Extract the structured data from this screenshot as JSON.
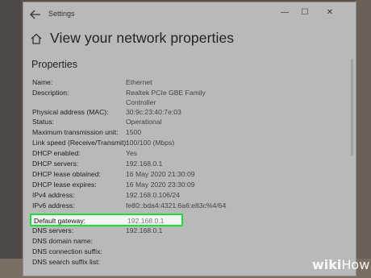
{
  "window": {
    "app_title": "Settings",
    "page_title": "View your network properties",
    "section_title": "Properties",
    "controls": {
      "minimize": "—",
      "maximize": "☐",
      "close": "✕"
    }
  },
  "properties": [
    {
      "label": "Name:",
      "value": "Ethernet"
    },
    {
      "label": "Description:",
      "value": "Realtek PCIe GBE Family"
    },
    {
      "label": "",
      "value": "Controller"
    },
    {
      "label": "Physical address (MAC):",
      "value": "30:9c:23:40:7e:03"
    },
    {
      "label": "Status:",
      "value": "Operational"
    },
    {
      "label": "Maximum transmission unit:",
      "value": "1500"
    },
    {
      "label": "Link speed (Receive/Transmit):",
      "value": "100/100 (Mbps)"
    },
    {
      "label": "DHCP enabled:",
      "value": "Yes"
    },
    {
      "label": "DHCP servers:",
      "value": "192.168.0.1"
    },
    {
      "label": "DHCP lease obtained:",
      "value": "16 May 2020 21:30:09"
    },
    {
      "label": "DHCP lease expires:",
      "value": "16 May 2020 23:30:09"
    },
    {
      "label": "IPv4 address:",
      "value": "192.168.0.106/24"
    },
    {
      "label": "IPv6 address:",
      "value": "fe80::bda4:4321:6a6:e83c%4/64"
    },
    {
      "label": "Default gateway:",
      "value": "192.168.0.1"
    },
    {
      "label": "DNS servers:",
      "value": "192.168.0.1"
    },
    {
      "label": "DNS domain name:",
      "value": ""
    },
    {
      "label": "DNS connection suffix:",
      "value": ""
    },
    {
      "label": "DNS search suffix list:",
      "value": ""
    }
  ],
  "highlight_color": "#17e03d",
  "watermark": {
    "bold": "wiki",
    "light": "How"
  }
}
